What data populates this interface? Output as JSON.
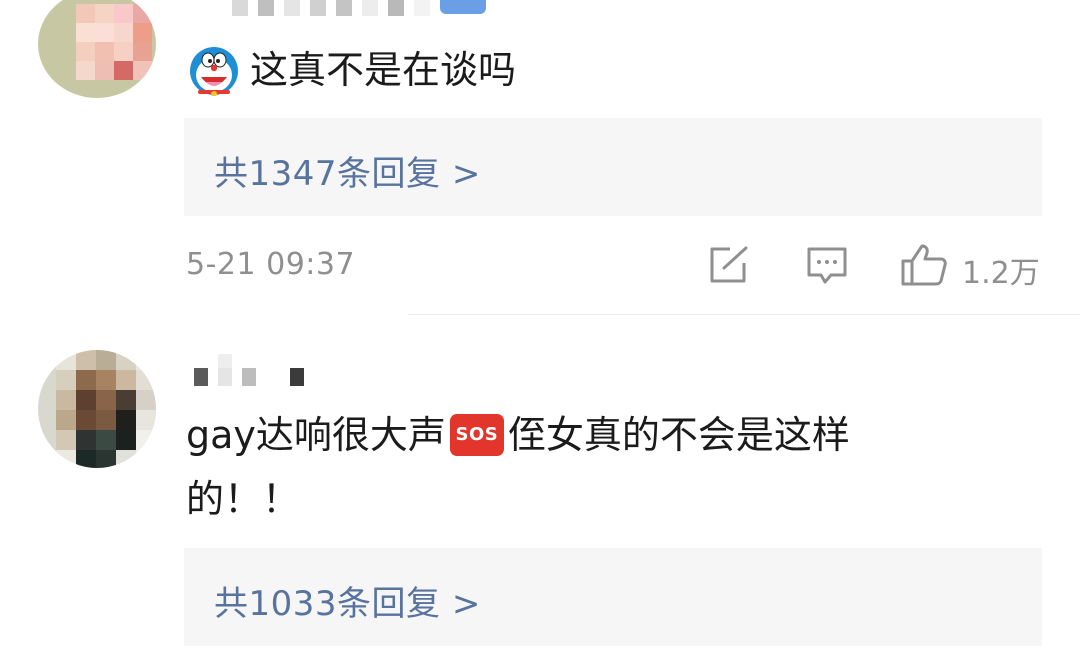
{
  "comments": [
    {
      "text": "这真不是在谈吗",
      "emoji_icon": "doraemon-icon",
      "reply_summary": "共1347条回复 >",
      "timestamp": "5-21 09:37",
      "likes": "1.2万"
    },
    {
      "text_before_badge": "gay达响很大声",
      "badge_text": "SOS",
      "text_after_badge": "侄女真的不会是这样",
      "text_line2": "的！！",
      "reply_summary": "共1033条回复 >"
    }
  ],
  "icons": {
    "share": "share-icon",
    "comment": "comment-icon",
    "like": "thumbs-up-icon"
  },
  "colors": {
    "link": "#58739d",
    "meta": "#8f8f8f",
    "reply_bg": "#f6f6f7",
    "sos_badge": "#e2362c"
  }
}
